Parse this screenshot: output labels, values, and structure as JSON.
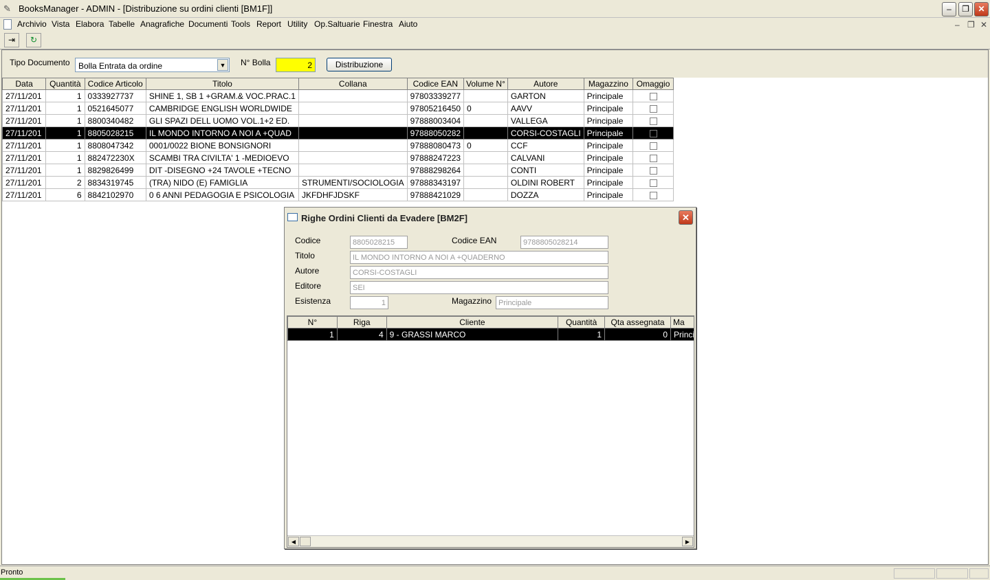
{
  "window": {
    "title": "BooksManager - ADMIN - [Distribuzione su ordini clienti  [BM1F]]"
  },
  "menu": [
    "Archivio",
    "Vista",
    "Elabora",
    "Tabelle",
    "Anagrafiche",
    "Documenti",
    "Tools",
    "Report",
    "Utility",
    "Op.Saltuarie",
    "Finestra",
    "Aiuto"
  ],
  "toolbar": {
    "exit_icon": "door-exit-icon",
    "refresh_icon": "refresh-icon"
  },
  "filter": {
    "tipo_label": "Tipo Documento",
    "tipo_value": "Bolla Entrata da ordine",
    "bolla_label": "N° Bolla",
    "bolla_value": "2",
    "button": "Distribuzione"
  },
  "grid": {
    "columns": [
      "Data",
      "Quantità",
      "Codice Articolo",
      "Titolo",
      "Collana",
      "Codice EAN",
      "Volume N°",
      "Autore",
      "Magazzino",
      "Omaggio"
    ],
    "rows": [
      {
        "data": "27/11/201",
        "qta": "1",
        "codice": "0333927737",
        "titolo": "SHINE 1, SB 1 +GRAM.& VOC.PRAC.1",
        "collana": "",
        "ean": "97803339277",
        "volume": "",
        "autore": "GARTON",
        "magazzino": "Principale"
      },
      {
        "data": "27/11/201",
        "qta": "1",
        "codice": "0521645077",
        "titolo": "CAMBRIDGE ENGLISH WORLDWIDE",
        "collana": "",
        "ean": "97805216450",
        "volume": "0",
        "autore": "AAVV",
        "magazzino": "Principale"
      },
      {
        "data": "27/11/201",
        "qta": "1",
        "codice": "8800340482",
        "titolo": "GLI SPAZI DELL UOMO VOL.1+2 ED.",
        "collana": "",
        "ean": "97888003404",
        "volume": "",
        "autore": "VALLEGA",
        "magazzino": "Principale"
      },
      {
        "data": "27/11/201",
        "qta": "1",
        "codice": "8805028215",
        "titolo": "IL MONDO INTORNO A NOI A +QUAD",
        "collana": "",
        "ean": "97888050282",
        "volume": "",
        "autore": "CORSI-COSTAGLI",
        "magazzino": "Principale"
      },
      {
        "data": "27/11/201",
        "qta": "1",
        "codice": "8808047342",
        "titolo": "0001/0022 BIONE BONSIGNORI",
        "collana": "",
        "ean": "97888080473",
        "volume": "0",
        "autore": "CCF",
        "magazzino": "Principale"
      },
      {
        "data": "27/11/201",
        "qta": "1",
        "codice": "882472230X",
        "titolo": "SCAMBI TRA CIVILTA' 1 -MEDIOEVO",
        "collana": "",
        "ean": "97888247223",
        "volume": "",
        "autore": "CALVANI",
        "magazzino": "Principale"
      },
      {
        "data": "27/11/201",
        "qta": "1",
        "codice": "8829826499",
        "titolo": "DIT -DISEGNO +24 TAVOLE +TECNO",
        "collana": "",
        "ean": "97888298264",
        "volume": "",
        "autore": "CONTI",
        "magazzino": "Principale"
      },
      {
        "data": "27/11/201",
        "qta": "2",
        "codice": "8834319745",
        "titolo": "(TRA) NIDO (E) FAMIGLIA",
        "collana": "STRUMENTI/SOCIOLOGIA",
        "ean": "97888343197",
        "volume": "",
        "autore": "OLDINI ROBERT",
        "magazzino": "Principale"
      },
      {
        "data": "27/11/201",
        "qta": "6",
        "codice": "8842102970",
        "titolo": "0 6 ANNI PEDAGOGIA E PSICOLOGIA",
        "collana": "JKFDHFJDSKF",
        "ean": "97888421029",
        "volume": "",
        "autore": "DOZZA",
        "magazzino": "Principale"
      }
    ]
  },
  "dialog": {
    "title": "Righe Ordini Clienti da Evadere  [BM2F]",
    "codice_label": "Codice",
    "codice": "8805028215",
    "ean_label": "Codice EAN",
    "ean": "9788805028214",
    "titolo_label": "Titolo",
    "titolo": "IL MONDO INTORNO A NOI A +QUADERNO",
    "autore_label": "Autore",
    "autore": "CORSI-COSTAGLI",
    "editore_label": "Editore",
    "editore": "SEI",
    "esistenza_label": "Esistenza",
    "esistenza": "1",
    "magazzino_label": "Magazzino",
    "magazzino": "Principale",
    "grid": {
      "columns": [
        "N°",
        "Riga",
        "Cliente",
        "Quantità",
        "Qta assegnata",
        "Ma"
      ],
      "rows": [
        {
          "n": "1",
          "riga": "4",
          "cliente": "9 - GRASSI MARCO",
          "qta": "1",
          "assegnata": "0",
          "mag": "Princi"
        }
      ]
    }
  },
  "status": {
    "text": "Pronto"
  }
}
